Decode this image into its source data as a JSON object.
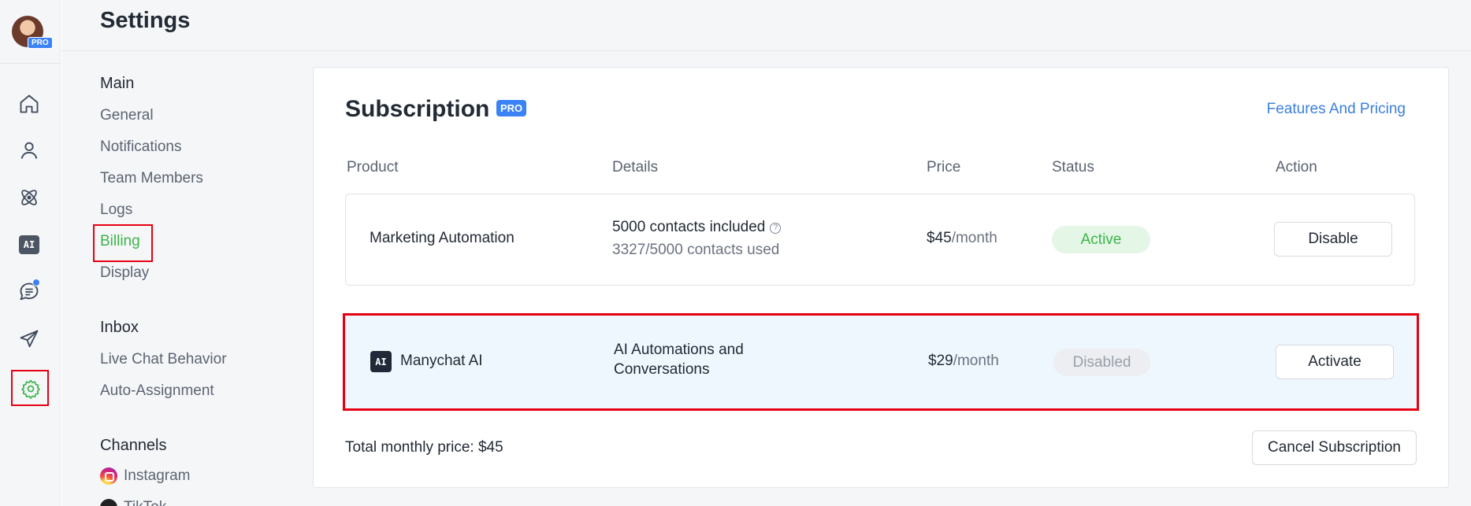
{
  "header": {
    "title": "Settings"
  },
  "rail": {
    "avatar_badge": "PRO",
    "icons": [
      "home-icon",
      "contacts-icon",
      "automation-icon",
      "ai-icon",
      "chat-icon",
      "send-icon",
      "settings-icon"
    ],
    "ai_label": "AI"
  },
  "nav": {
    "sections": [
      {
        "title": "Main",
        "items": [
          "General",
          "Notifications",
          "Team Members",
          "Logs",
          "Billing",
          "Display"
        ]
      },
      {
        "title": "Inbox",
        "items": [
          "Live Chat Behavior",
          "Auto-Assignment"
        ]
      },
      {
        "title": "Channels",
        "items": [
          "Instagram",
          "TikTok"
        ]
      }
    ],
    "active_item": "Billing"
  },
  "subscription": {
    "title": "Subscription",
    "badge": "PRO",
    "features_link": "Features And Pricing",
    "columns": [
      "Product",
      "Details",
      "Price",
      "Status",
      "Action"
    ],
    "rows": [
      {
        "product": "Marketing Automation",
        "details_line1": "5000 contacts included",
        "details_line2": "3327/5000 contacts used",
        "help_glyph": "?",
        "price": "$45",
        "price_unit": "/month",
        "status": "Active",
        "action": "Disable"
      },
      {
        "product_icon": "AI",
        "product": "Manychat AI",
        "details_line1": "AI Automations and",
        "details_line2": "Conversations",
        "price": "$29",
        "price_unit": "/month",
        "status": "Disabled",
        "action": "Activate"
      }
    ],
    "total": "Total monthly price: $45",
    "cancel_button": "Cancel Subscription"
  },
  "colors": {
    "accent_green": "#3bb54a",
    "link_blue": "#3b7fdd",
    "badge_blue": "#3b82f6",
    "highlight_red": "#e60012"
  }
}
